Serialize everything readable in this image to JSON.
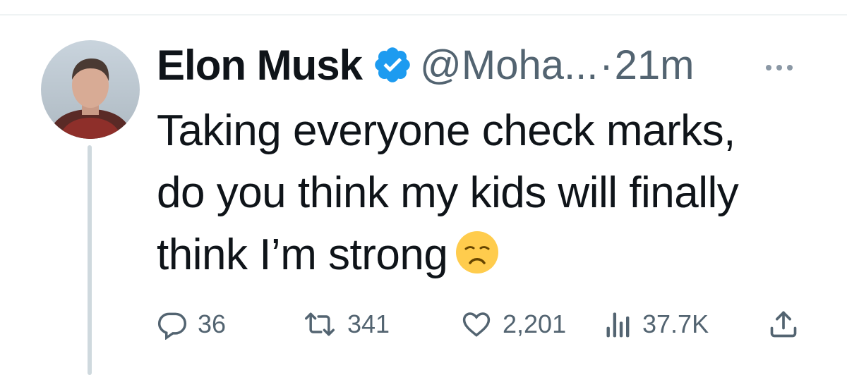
{
  "tweet": {
    "author_name": "Elon Musk",
    "handle": "@Moha...",
    "separator": "·",
    "time": "21m",
    "text_lines": [
      "Taking everyone check marks,",
      "do you think my kids will finally",
      "think I’m strong"
    ],
    "emoji": "disappointed-face"
  },
  "actions": {
    "replies": "36",
    "retweets": "341",
    "likes": "2,201",
    "views": "37.7K"
  },
  "colors": {
    "text": "#0f1419",
    "muted": "#536471",
    "verified": "#1d9bf0",
    "divider": "#cfd9de"
  },
  "icons": [
    "verified-badge-icon",
    "more-icon",
    "reply-icon",
    "retweet-icon",
    "like-icon",
    "views-icon",
    "share-icon"
  ]
}
